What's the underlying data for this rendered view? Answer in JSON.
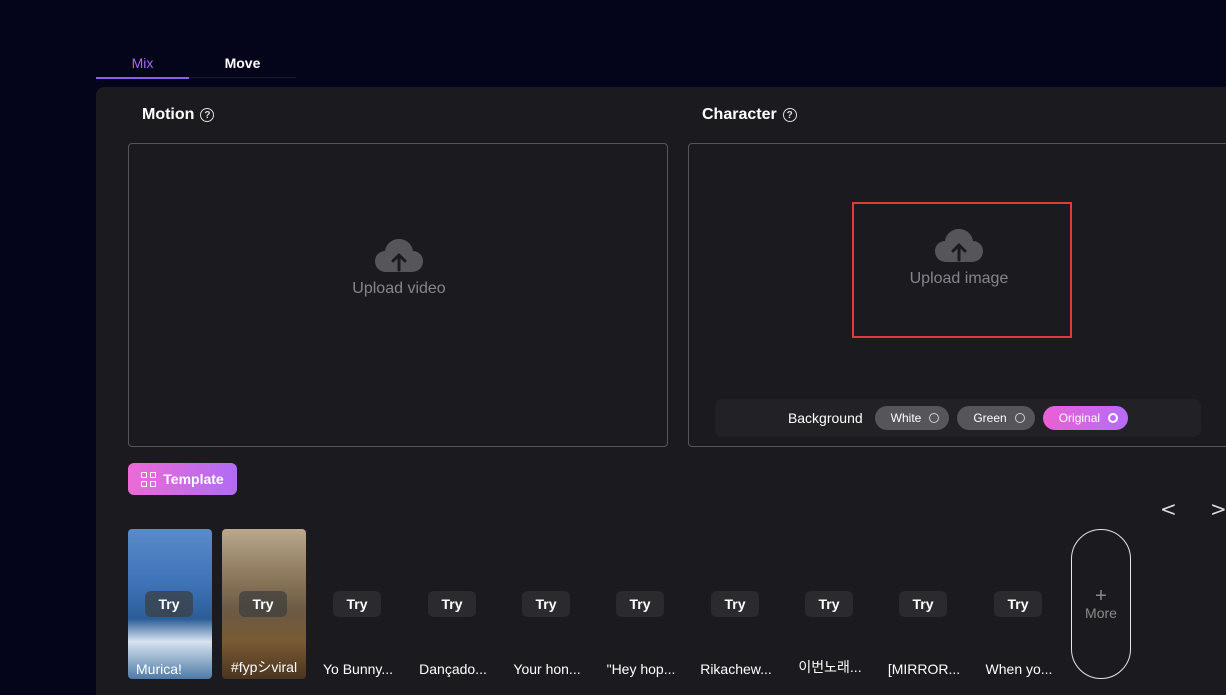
{
  "tabs": [
    {
      "label": "Mix",
      "active": true
    },
    {
      "label": "Move",
      "active": false
    }
  ],
  "motion": {
    "title": "Motion",
    "upload_text": "Upload video"
  },
  "character": {
    "title": "Character",
    "upload_text": "Upload image"
  },
  "background": {
    "label": "Background",
    "options": [
      {
        "label": "White",
        "selected": false
      },
      {
        "label": "Green",
        "selected": false
      },
      {
        "label": "Original",
        "selected": true
      }
    ]
  },
  "template_button": "Template",
  "nav": {
    "prev": "<",
    "next": ">"
  },
  "try_label": "Try",
  "templates": [
    {
      "label": "Murica!"
    },
    {
      "label": "#fypシviral"
    },
    {
      "label": "Yo Bunny..."
    },
    {
      "label": "Dançado..."
    },
    {
      "label": "Your hon..."
    },
    {
      "label": "\"Hey hop..."
    },
    {
      "label": "Rikachew..."
    },
    {
      "label": "이번노래..."
    },
    {
      "label": "[MIRROR..."
    },
    {
      "label": "When yo..."
    }
  ],
  "more_button": {
    "icon": "+",
    "label": "More"
  },
  "colors": {
    "accent": "#8b5cf6",
    "highlight": "#e03a3a",
    "gradient_start": "#ec6ad6",
    "gradient_end": "#b06cf5"
  }
}
